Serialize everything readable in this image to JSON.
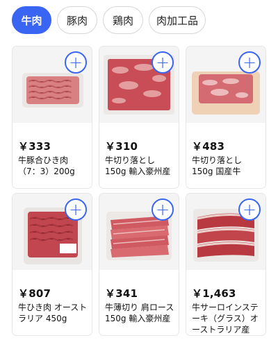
{
  "tabs": [
    {
      "label": "牛肉",
      "active": true
    },
    {
      "label": "豚肉",
      "active": false
    },
    {
      "label": "鶏肉",
      "active": false
    },
    {
      "label": "肉加工品",
      "active": false
    }
  ],
  "add_icon": "+",
  "products": [
    {
      "price": "￥333",
      "name": "牛豚合ひき肉（7：3）200g",
      "image": "ground-beef-pork-tray-photo"
    },
    {
      "price": "￥310",
      "name": "牛切り落とし150g 輸入豪州産",
      "image": "beef-scraps-tray-photo"
    },
    {
      "price": "￥483",
      "name": "牛切り落とし150g 国産牛",
      "image": "beef-scraps-domestic-tray-photo"
    },
    {
      "price": "￥807",
      "name": "牛ひき肉 オーストラリア 450g",
      "image": "ground-beef-pack-photo"
    },
    {
      "price": "￥341",
      "name": "牛薄切り 肩ロース 150g 輸入豪州産",
      "image": "sliced-shoulder-loin-photo"
    },
    {
      "price": "￥1,463",
      "name": "牛サーロインステーキ（グラス）オーストラリア産",
      "image": "sirloin-steak-photo"
    }
  ],
  "colors": {
    "accent": "#3a64f2",
    "meat": "#c94b52"
  }
}
